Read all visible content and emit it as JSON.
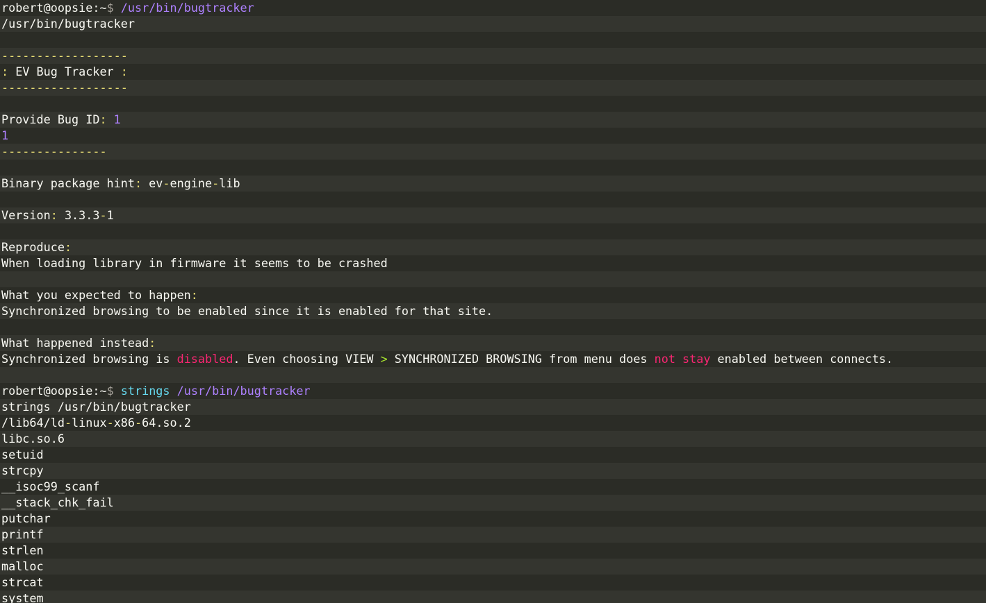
{
  "colors": {
    "background": "#272822",
    "row_alt": "#34352f",
    "text": "#f8f8f2",
    "prompt_symbol": "#a6a29a",
    "command": "#ae81ff",
    "command_alt": "#66d9ef",
    "punctuation": "#e6db74",
    "number": "#ae81ff",
    "emphasis_red": "#f92672",
    "operator": "#a6e22e"
  },
  "terminal": {
    "lines": [
      [
        {
          "t": "robert@oopsie:~",
          "c": "prompt"
        },
        {
          "t": "$ ",
          "c": "ps"
        },
        {
          "t": "/usr/bin/bugtracker",
          "c": "cmd"
        }
      ],
      [
        {
          "t": "/usr/bin/bugtracker",
          "c": "default"
        }
      ],
      [],
      [
        {
          "t": "------------------",
          "c": "dash"
        }
      ],
      [
        {
          "t": ":",
          "c": "punct"
        },
        {
          "t": " EV Bug Tracker ",
          "c": "default"
        },
        {
          "t": ":",
          "c": "punct"
        }
      ],
      [
        {
          "t": "------------------",
          "c": "dash"
        }
      ],
      [],
      [
        {
          "t": "Provide Bug ID",
          "c": "default"
        },
        {
          "t": ":",
          "c": "punct"
        },
        {
          "t": " ",
          "c": "default"
        },
        {
          "t": "1",
          "c": "num"
        }
      ],
      [
        {
          "t": "1",
          "c": "num"
        }
      ],
      [
        {
          "t": "---------------",
          "c": "dash"
        }
      ],
      [],
      [
        {
          "t": "Binary package hint",
          "c": "default"
        },
        {
          "t": ":",
          "c": "punct"
        },
        {
          "t": " ev",
          "c": "default"
        },
        {
          "t": "-",
          "c": "punct"
        },
        {
          "t": "engine",
          "c": "default"
        },
        {
          "t": "-",
          "c": "punct"
        },
        {
          "t": "lib",
          "c": "default"
        }
      ],
      [],
      [
        {
          "t": "Version",
          "c": "default"
        },
        {
          "t": ":",
          "c": "punct"
        },
        {
          "t": " 3.3.3",
          "c": "default"
        },
        {
          "t": "-",
          "c": "punct"
        },
        {
          "t": "1",
          "c": "default"
        }
      ],
      [],
      [
        {
          "t": "Reproduce",
          "c": "default"
        },
        {
          "t": ":",
          "c": "punct"
        }
      ],
      [
        {
          "t": "When loading library in firmware it seems to be crashed",
          "c": "default"
        }
      ],
      [],
      [
        {
          "t": "What you expected to happen",
          "c": "default"
        },
        {
          "t": ":",
          "c": "punct"
        }
      ],
      [
        {
          "t": "Synchronized browsing to be enabled since it is enabled for that site.",
          "c": "default"
        }
      ],
      [],
      [
        {
          "t": "What happened instead",
          "c": "default"
        },
        {
          "t": ":",
          "c": "punct"
        }
      ],
      [
        {
          "t": "Synchronized browsing is ",
          "c": "default"
        },
        {
          "t": "disabled",
          "c": "red"
        },
        {
          "t": ". Even choosing VIEW ",
          "c": "default"
        },
        {
          "t": ">",
          "c": "gt"
        },
        {
          "t": " SYNCHRONIZED BROWSING from menu does ",
          "c": "default"
        },
        {
          "t": "not stay",
          "c": "red"
        },
        {
          "t": " enabled between connects.",
          "c": "default"
        }
      ],
      [],
      [
        {
          "t": "robert@oopsie:~",
          "c": "prompt"
        },
        {
          "t": "$ ",
          "c": "ps"
        },
        {
          "t": "strings",
          "c": "cmd2"
        },
        {
          "t": " /usr/bin/bugtracker",
          "c": "cmd"
        }
      ],
      [
        {
          "t": "strings /usr/bin/bugtracker",
          "c": "default"
        }
      ],
      [
        {
          "t": "/lib64/ld",
          "c": "default"
        },
        {
          "t": "-",
          "c": "punct"
        },
        {
          "t": "linux",
          "c": "default"
        },
        {
          "t": "-",
          "c": "punct"
        },
        {
          "t": "x86",
          "c": "default"
        },
        {
          "t": "-",
          "c": "punct"
        },
        {
          "t": "64.so.2",
          "c": "default"
        }
      ],
      [
        {
          "t": "libc.so.6",
          "c": "default"
        }
      ],
      [
        {
          "t": "setuid",
          "c": "default"
        }
      ],
      [
        {
          "t": "strcpy",
          "c": "default"
        }
      ],
      [
        {
          "t": "__isoc99_scanf",
          "c": "default"
        }
      ],
      [
        {
          "t": "__stack_chk_fail",
          "c": "default"
        }
      ],
      [
        {
          "t": "putchar",
          "c": "default"
        }
      ],
      [
        {
          "t": "printf",
          "c": "default"
        }
      ],
      [
        {
          "t": "strlen",
          "c": "default"
        }
      ],
      [
        {
          "t": "malloc",
          "c": "default"
        }
      ],
      [
        {
          "t": "strcat",
          "c": "default"
        }
      ],
      [
        {
          "t": "system",
          "c": "default"
        }
      ]
    ]
  }
}
